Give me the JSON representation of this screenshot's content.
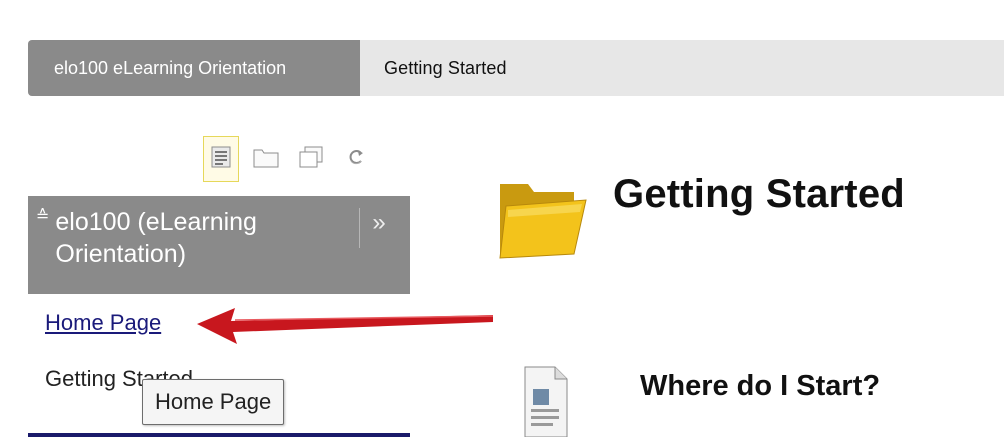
{
  "breadcrumb": {
    "course": "elo100 eLearning Orientation",
    "current": "Getting Started"
  },
  "toolbar": {
    "icons": [
      "list-view-icon",
      "folder-view-icon",
      "window-view-icon",
      "refresh-icon"
    ]
  },
  "course_menu": {
    "title": "elo100 (eLearning Orientation)",
    "collapse_glyph": "≈",
    "expand_glyph": "»",
    "items": [
      {
        "label": "Home Page",
        "link": true
      },
      {
        "label": "Getting Started",
        "link": false
      }
    ]
  },
  "tooltip": {
    "text": "Home Page"
  },
  "content": {
    "title": "Getting Started",
    "items": [
      {
        "title": "Where do I Start?",
        "icon": "document-icon"
      }
    ]
  },
  "colors": {
    "breadcrumb_bg": "#e7e7e7",
    "course_crumb_bg": "#8a8a8a",
    "menu_header_bg": "#8a8a8a",
    "link": "#1a1a7a",
    "arrow": "#c8171e",
    "folder": "#f2c21a"
  }
}
